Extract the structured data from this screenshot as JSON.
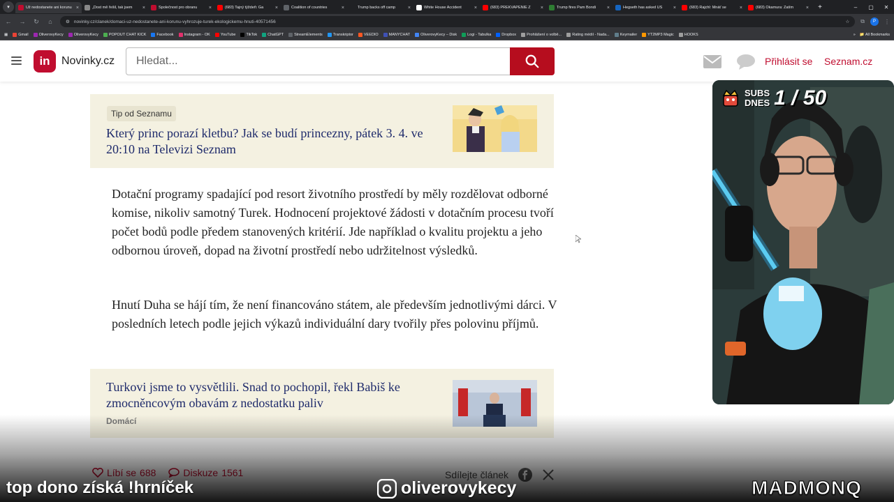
{
  "browser": {
    "tabs": [
      {
        "title": "Už nedostanete ani korunu",
        "color": "#c00d2f",
        "active": true
      },
      {
        "title": "„Dost mě řešil, tak jsem",
        "color": "#888888",
        "active": false
      },
      {
        "title": "Společnost pro obranu",
        "color": "#c00d2f",
        "active": false
      },
      {
        "title": "(683) Tajný týždeň: Ga",
        "color": "#ff0000",
        "active": false
      },
      {
        "title": "Coalition of countries",
        "color": "#5f6368",
        "active": false
      },
      {
        "title": "Trump backs off camp",
        "color": "#202124",
        "active": false
      },
      {
        "title": "White House Accident",
        "color": "#ffffff",
        "active": false
      },
      {
        "title": "(683) PREKVAPENIE Z",
        "color": "#ff0000",
        "active": false
      },
      {
        "title": "Trump fires Pam Bondi",
        "color": "#2e7d32",
        "active": false
      },
      {
        "title": "Hegseth has asked US",
        "color": "#1565c0",
        "active": false
      },
      {
        "title": "(683) Rajchl: Mnáť se",
        "color": "#ff0000",
        "active": false
      },
      {
        "title": "(683) Okamura: Zatím",
        "color": "#ff0000",
        "active": false
      }
    ],
    "url": "novinky.cz/clanek/domaci-uz-nedostanete-ani-korunu-vyhrozuje-turek-ekologickemu-hnuti-40571456",
    "bookmarks": [
      "Gmail",
      "OliverovyKecy",
      "OliverovyKecy",
      "POPOUT CHAT KICK",
      "Facebook",
      "Instagram - OK",
      "YouTube",
      "TikTok",
      "ChatGPT",
      "StreamElements",
      "Transkriptor",
      "VEEDIO",
      "MANYCHAT",
      "OliverovyKecy – Disk",
      "Logi - Tabulka",
      "Dropbox",
      "Prohlášení o volbě...",
      "Rating médií - Nada...",
      "Keymailer",
      "YT2MP3 Magic",
      "HOOKS"
    ],
    "all_bookmarks": "All Bookmarks",
    "profile_initial": "P"
  },
  "header": {
    "logo_text": "in",
    "brand": "Novinky.cz",
    "search_placeholder": "Hledat...",
    "login": "Přihlásit se",
    "seznam": "Seznam.cz"
  },
  "article": {
    "promo1": {
      "tag": "Tip od Seznamu",
      "title": "Který princ porazí kletbu? Jak se budí princezny, pátek 3. 4. ve 20:10 na Televizi Seznam"
    },
    "paragraphs": [
      "Dotační programy spadající pod resort životního prostředí by měly rozdělovat odborné komise, nikoliv samotný Turek. Hodnocení projektové žádosti v dotačním procesu tvoří počet bodů podle předem stanovených kritérií. Jde například o kvalitu projektu a jeho odbornou úroveň, dopad na životní prostředí nebo udržitelnost výsledků.",
      "Hnutí Duha se hájí tím, že není financováno státem, ale především jednotlivými dárci. V posledních letech podle jejich výkazů individuální dary tvořily přes polovinu příjmů."
    ],
    "promo2": {
      "title": "Turkovi jsme to vysvětlili. Snad to pochopil, řekl Babiš ke zmocněncovým obavám z nedostatku paliv",
      "category": "Domácí"
    },
    "likes_label": "Líbí se",
    "likes_count": "688",
    "discussion_label": "Diskuze",
    "discussion_count": "1561",
    "share_label": "Sdílejte článek"
  },
  "overlay": {
    "left_text": "top dono získá !hrníček",
    "center_text": "oliverovykecy",
    "right_text": "MADMONQ",
    "subs_label": "SUBS\nDNES",
    "subs_count": "1 / 50"
  },
  "colors": {
    "brand_red": "#c00d2f",
    "promo_bg": "#f4f1e1",
    "link_navy": "#1e2a6b"
  }
}
